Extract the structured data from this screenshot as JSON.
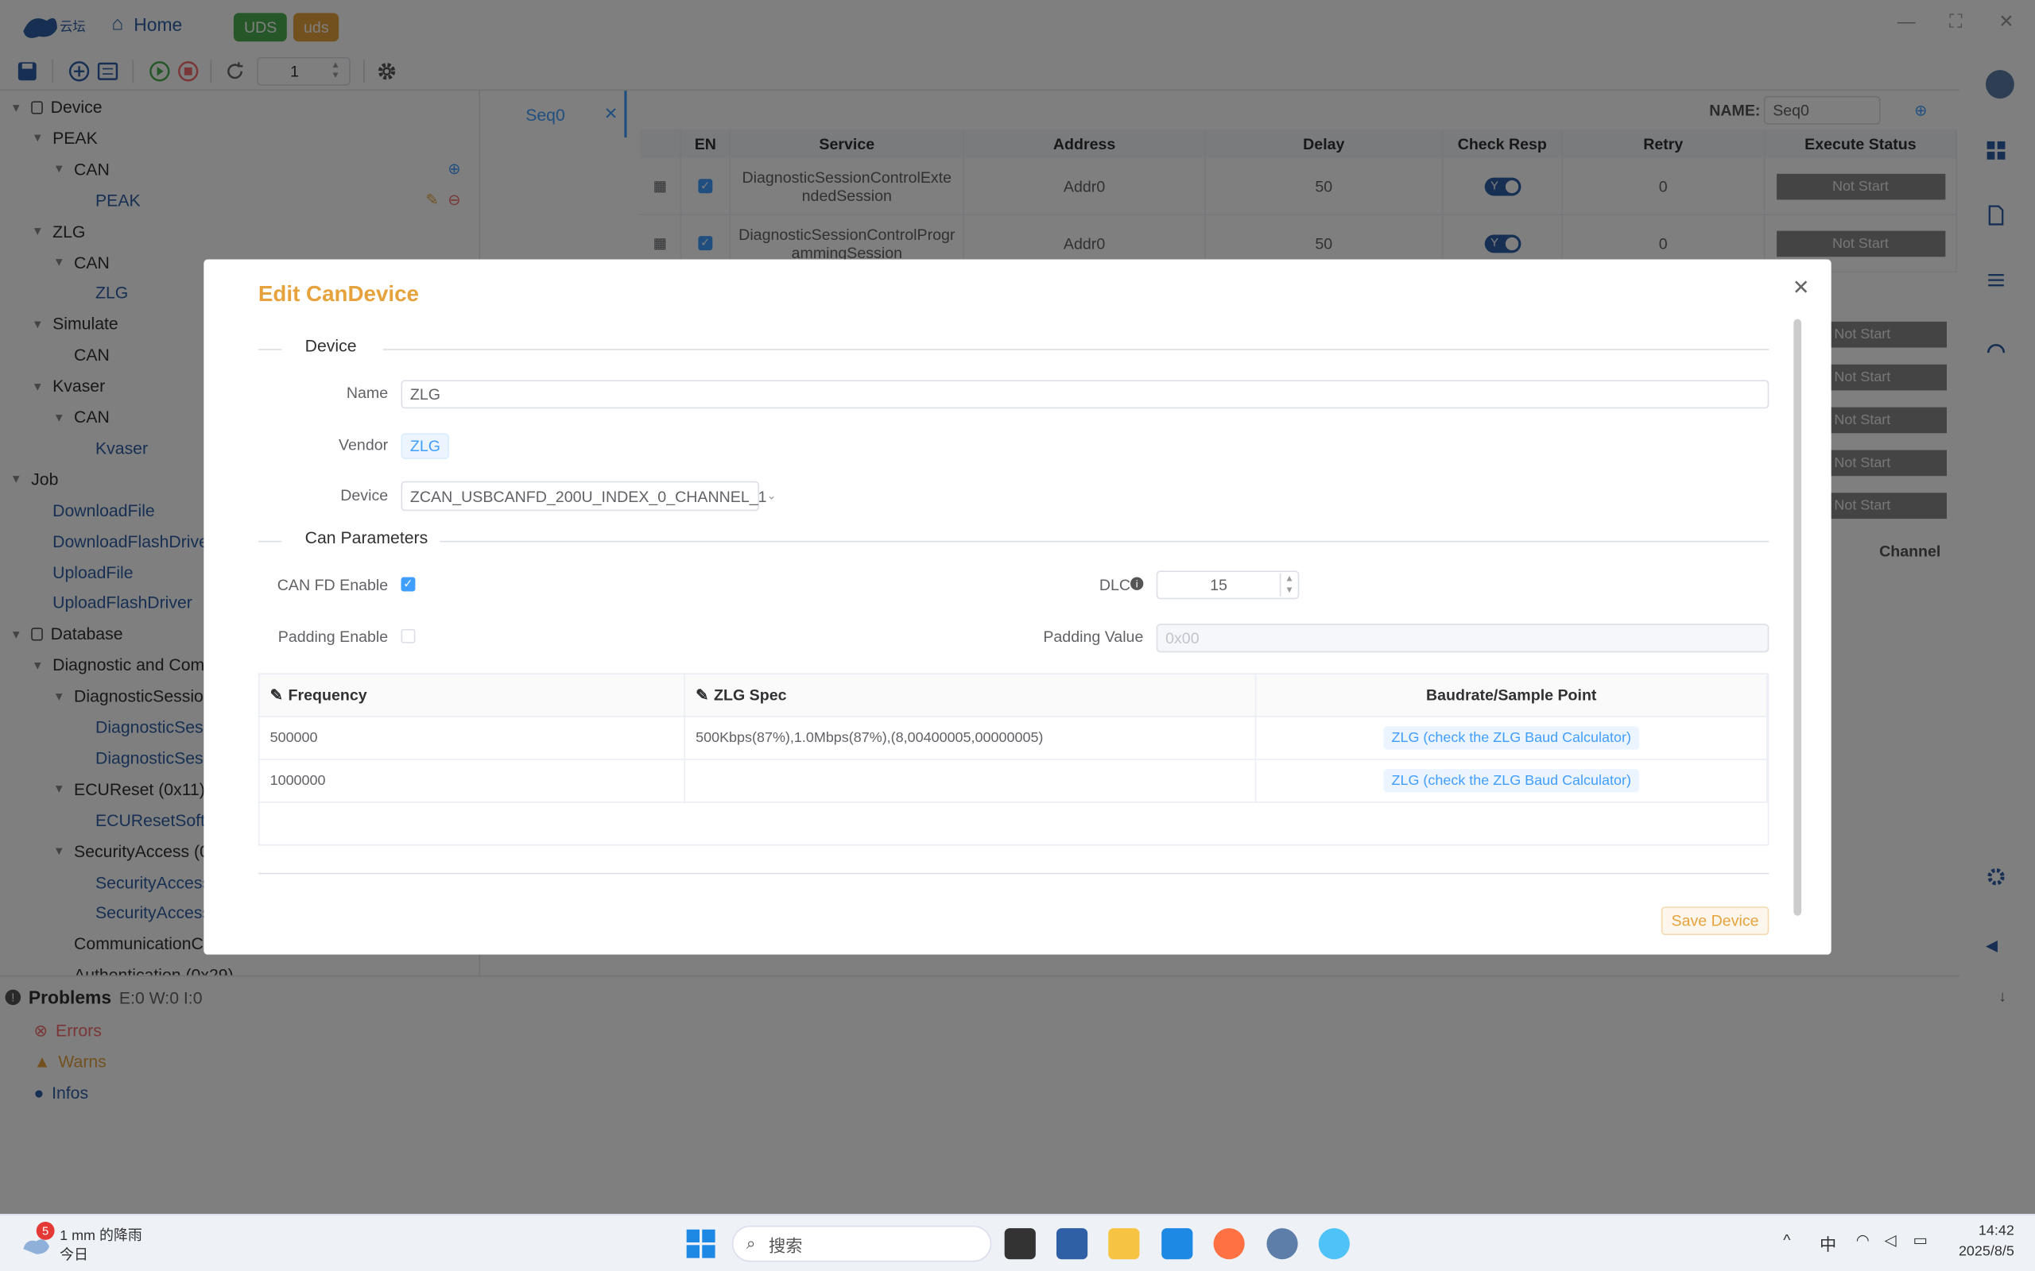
{
  "app": {
    "home": "Home",
    "badge_uds_upper": "UDS",
    "badge_uds_lower": "uds",
    "seq_count": "1"
  },
  "sidebar": {
    "items": [
      {
        "label": "Device",
        "indent": 0,
        "arrow": "▼",
        "icon": "device"
      },
      {
        "label": "PEAK",
        "indent": 1,
        "arrow": "▼"
      },
      {
        "label": "CAN",
        "indent": 2,
        "arrow": "▼"
      },
      {
        "label": "PEAK",
        "indent": 3,
        "link": true
      },
      {
        "label": "ZLG",
        "indent": 1,
        "arrow": "▼"
      },
      {
        "label": "CAN",
        "indent": 2,
        "arrow": "▼"
      },
      {
        "label": "ZLG",
        "indent": 3,
        "link": true
      },
      {
        "label": "Simulate",
        "indent": 1,
        "arrow": "▼"
      },
      {
        "label": "CAN",
        "indent": 2
      },
      {
        "label": "Kvaser",
        "indent": 1,
        "arrow": "▼"
      },
      {
        "label": "CAN",
        "indent": 2,
        "arrow": "▼"
      },
      {
        "label": "Kvaser",
        "indent": 3,
        "link": true
      },
      {
        "label": "Job",
        "indent": 0,
        "arrow": "▼"
      },
      {
        "label": "DownloadFile",
        "indent": 1,
        "link": true
      },
      {
        "label": "DownloadFlashDrive",
        "indent": 1,
        "link": true
      },
      {
        "label": "UploadFile",
        "indent": 1,
        "link": true
      },
      {
        "label": "UploadFlashDriver",
        "indent": 1,
        "link": true
      },
      {
        "label": "Database",
        "indent": 0,
        "arrow": "▼",
        "icon": "db"
      },
      {
        "label": "Diagnostic and Com",
        "indent": 1,
        "arrow": "▼"
      },
      {
        "label": "DiagnosticSession",
        "indent": 2,
        "arrow": "▼"
      },
      {
        "label": "DiagnosticSes",
        "indent": 3,
        "link": true
      },
      {
        "label": "DiagnosticSes",
        "indent": 3,
        "link": true
      },
      {
        "label": "ECUReset (0x11)",
        "indent": 2,
        "arrow": "▼"
      },
      {
        "label": "ECUResetSoftw",
        "indent": 3,
        "link": true
      },
      {
        "label": "SecurityAccess (0:",
        "indent": 2,
        "arrow": "▼"
      },
      {
        "label": "SecurityAccess",
        "indent": 3,
        "link": true
      },
      {
        "label": "SecurityAccess",
        "indent": 3,
        "link": true
      },
      {
        "label": "CommunicationC",
        "indent": 2
      },
      {
        "label": "Authentication (0x29)",
        "indent": 2
      }
    ]
  },
  "seq": {
    "tab": "Seq0",
    "name_label": "NAME:",
    "name_value": "Seq0"
  },
  "table": {
    "headers": [
      "EN",
      "Service",
      "Address",
      "Delay",
      "Check Resp",
      "Retry",
      "Execute Status"
    ],
    "rows": [
      {
        "service": "DiagnosticSessionControlExtendedSession",
        "address": "Addr0",
        "delay": "50",
        "check": "Y",
        "retry": "0",
        "status": "Not Start"
      },
      {
        "service": "DiagnosticSessionControlProgrammingSession",
        "address": "Addr0",
        "delay": "50",
        "check": "Y",
        "retry": "0",
        "status": "Not Start"
      }
    ],
    "extra_status": [
      "Not Start",
      "Not Start",
      "Not Start",
      "Not Start",
      "Not Start"
    ],
    "channel_header": "Channel"
  },
  "problems": {
    "title": "Problems",
    "counts": "E:0 W:0 I:0",
    "errors": "Errors",
    "warns": "Warns",
    "infos": "Infos"
  },
  "modal": {
    "title": "Edit CanDevice",
    "device_section": "Device",
    "name_label": "Name",
    "name_value": "ZLG",
    "vendor_label": "Vendor",
    "vendor_value": "ZLG",
    "device_label": "Device",
    "device_value": "ZCAN_USBCANFD_200U_INDEX_0_CHANNEL_1",
    "can_section": "Can Parameters",
    "canfd_label": "CAN FD Enable",
    "dlc_label": "DLC",
    "dlc_value": "15",
    "padding_label": "Padding Enable",
    "padval_label": "Padding Value",
    "padval_placeholder": "0x00",
    "table": {
      "headers": [
        "Frequency",
        "ZLG Spec",
        "Baudrate/Sample Point"
      ],
      "rows": [
        {
          "freq": "500000",
          "spec": "500Kbps(87%),1.0Mbps(87%),(8,00400005,00000005)",
          "baud": "ZLG (check the ZLG Baud Calculator)"
        },
        {
          "freq": "1000000",
          "spec": "",
          "baud": "ZLG (check the ZLG Baud Calculator)"
        }
      ]
    },
    "save": "Save Device"
  },
  "taskbar": {
    "weather_badge": "5",
    "weather_line1": "1 mm 的降雨",
    "weather_line2": "今日",
    "search": "搜索",
    "ime": "中",
    "time": "14:42",
    "date": "2025/8/5"
  }
}
